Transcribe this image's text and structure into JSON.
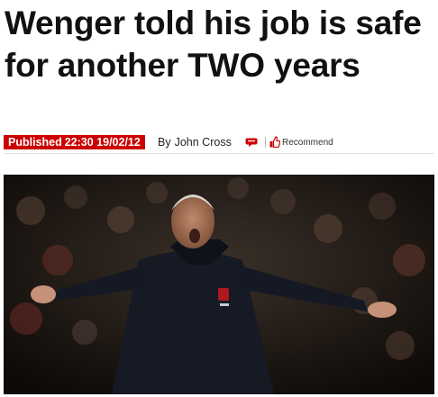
{
  "article": {
    "headline": "Wenger told his job is safe for another TWO years",
    "published_label": "Published",
    "published_time": "22:30 19/02/12",
    "by_label": "By",
    "author": "John Cross",
    "recommend_label": "Recommend"
  },
  "icons": {
    "comment": "comment-bubble-icon",
    "recommend": "thumbs-up-icon"
  },
  "colors": {
    "published_badge": "#cc0000",
    "headline_text": "#111111"
  }
}
